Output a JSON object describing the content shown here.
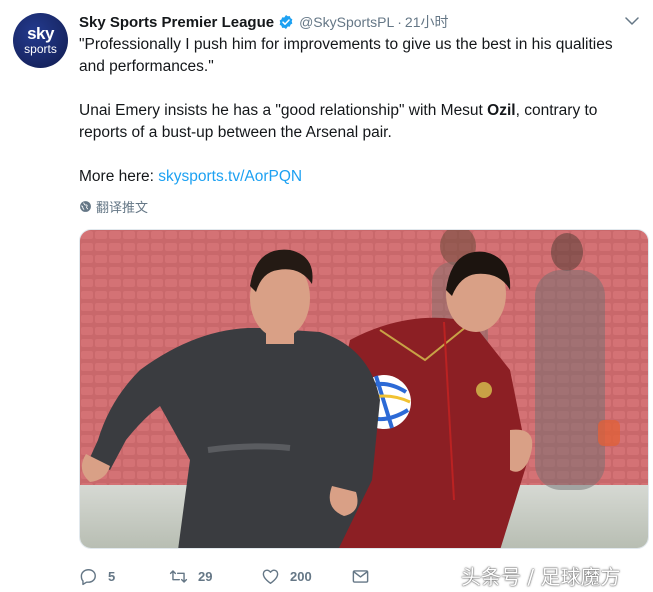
{
  "account": {
    "avatar_top": "sky",
    "avatar_bottom": "sports",
    "name": "Sky Sports Premier League",
    "handle": "@SkySportsPL",
    "separator": "·",
    "time": "21小时"
  },
  "tweet": {
    "para1": "\"Professionally I push him for improvements to give us the best in his qualities and performances.\"",
    "para2_pre": "Unai Emery insists he has a \"good relationship\" with Mesut ",
    "para2_bold": "Ozil",
    "para2_post": ", contrary to reports of a bust-up between the Arsenal pair.",
    "more_label": "More here: ",
    "more_link": "skysports.tv/AorPQN"
  },
  "translate_label": "翻译推文",
  "actions": {
    "replies": "5",
    "retweets": "29",
    "likes": "200"
  },
  "watermark": "头条号 / 足球魔方",
  "colors": {
    "link": "#1da1f2",
    "verified": "#1da1f2",
    "muted": "#657786",
    "avatar_bg": "#1a2a6c"
  },
  "icons": [
    "verified-badge-icon",
    "chevron-down-icon",
    "globe-icon",
    "reply-icon",
    "retweet-icon",
    "heart-icon",
    "mail-icon"
  ]
}
